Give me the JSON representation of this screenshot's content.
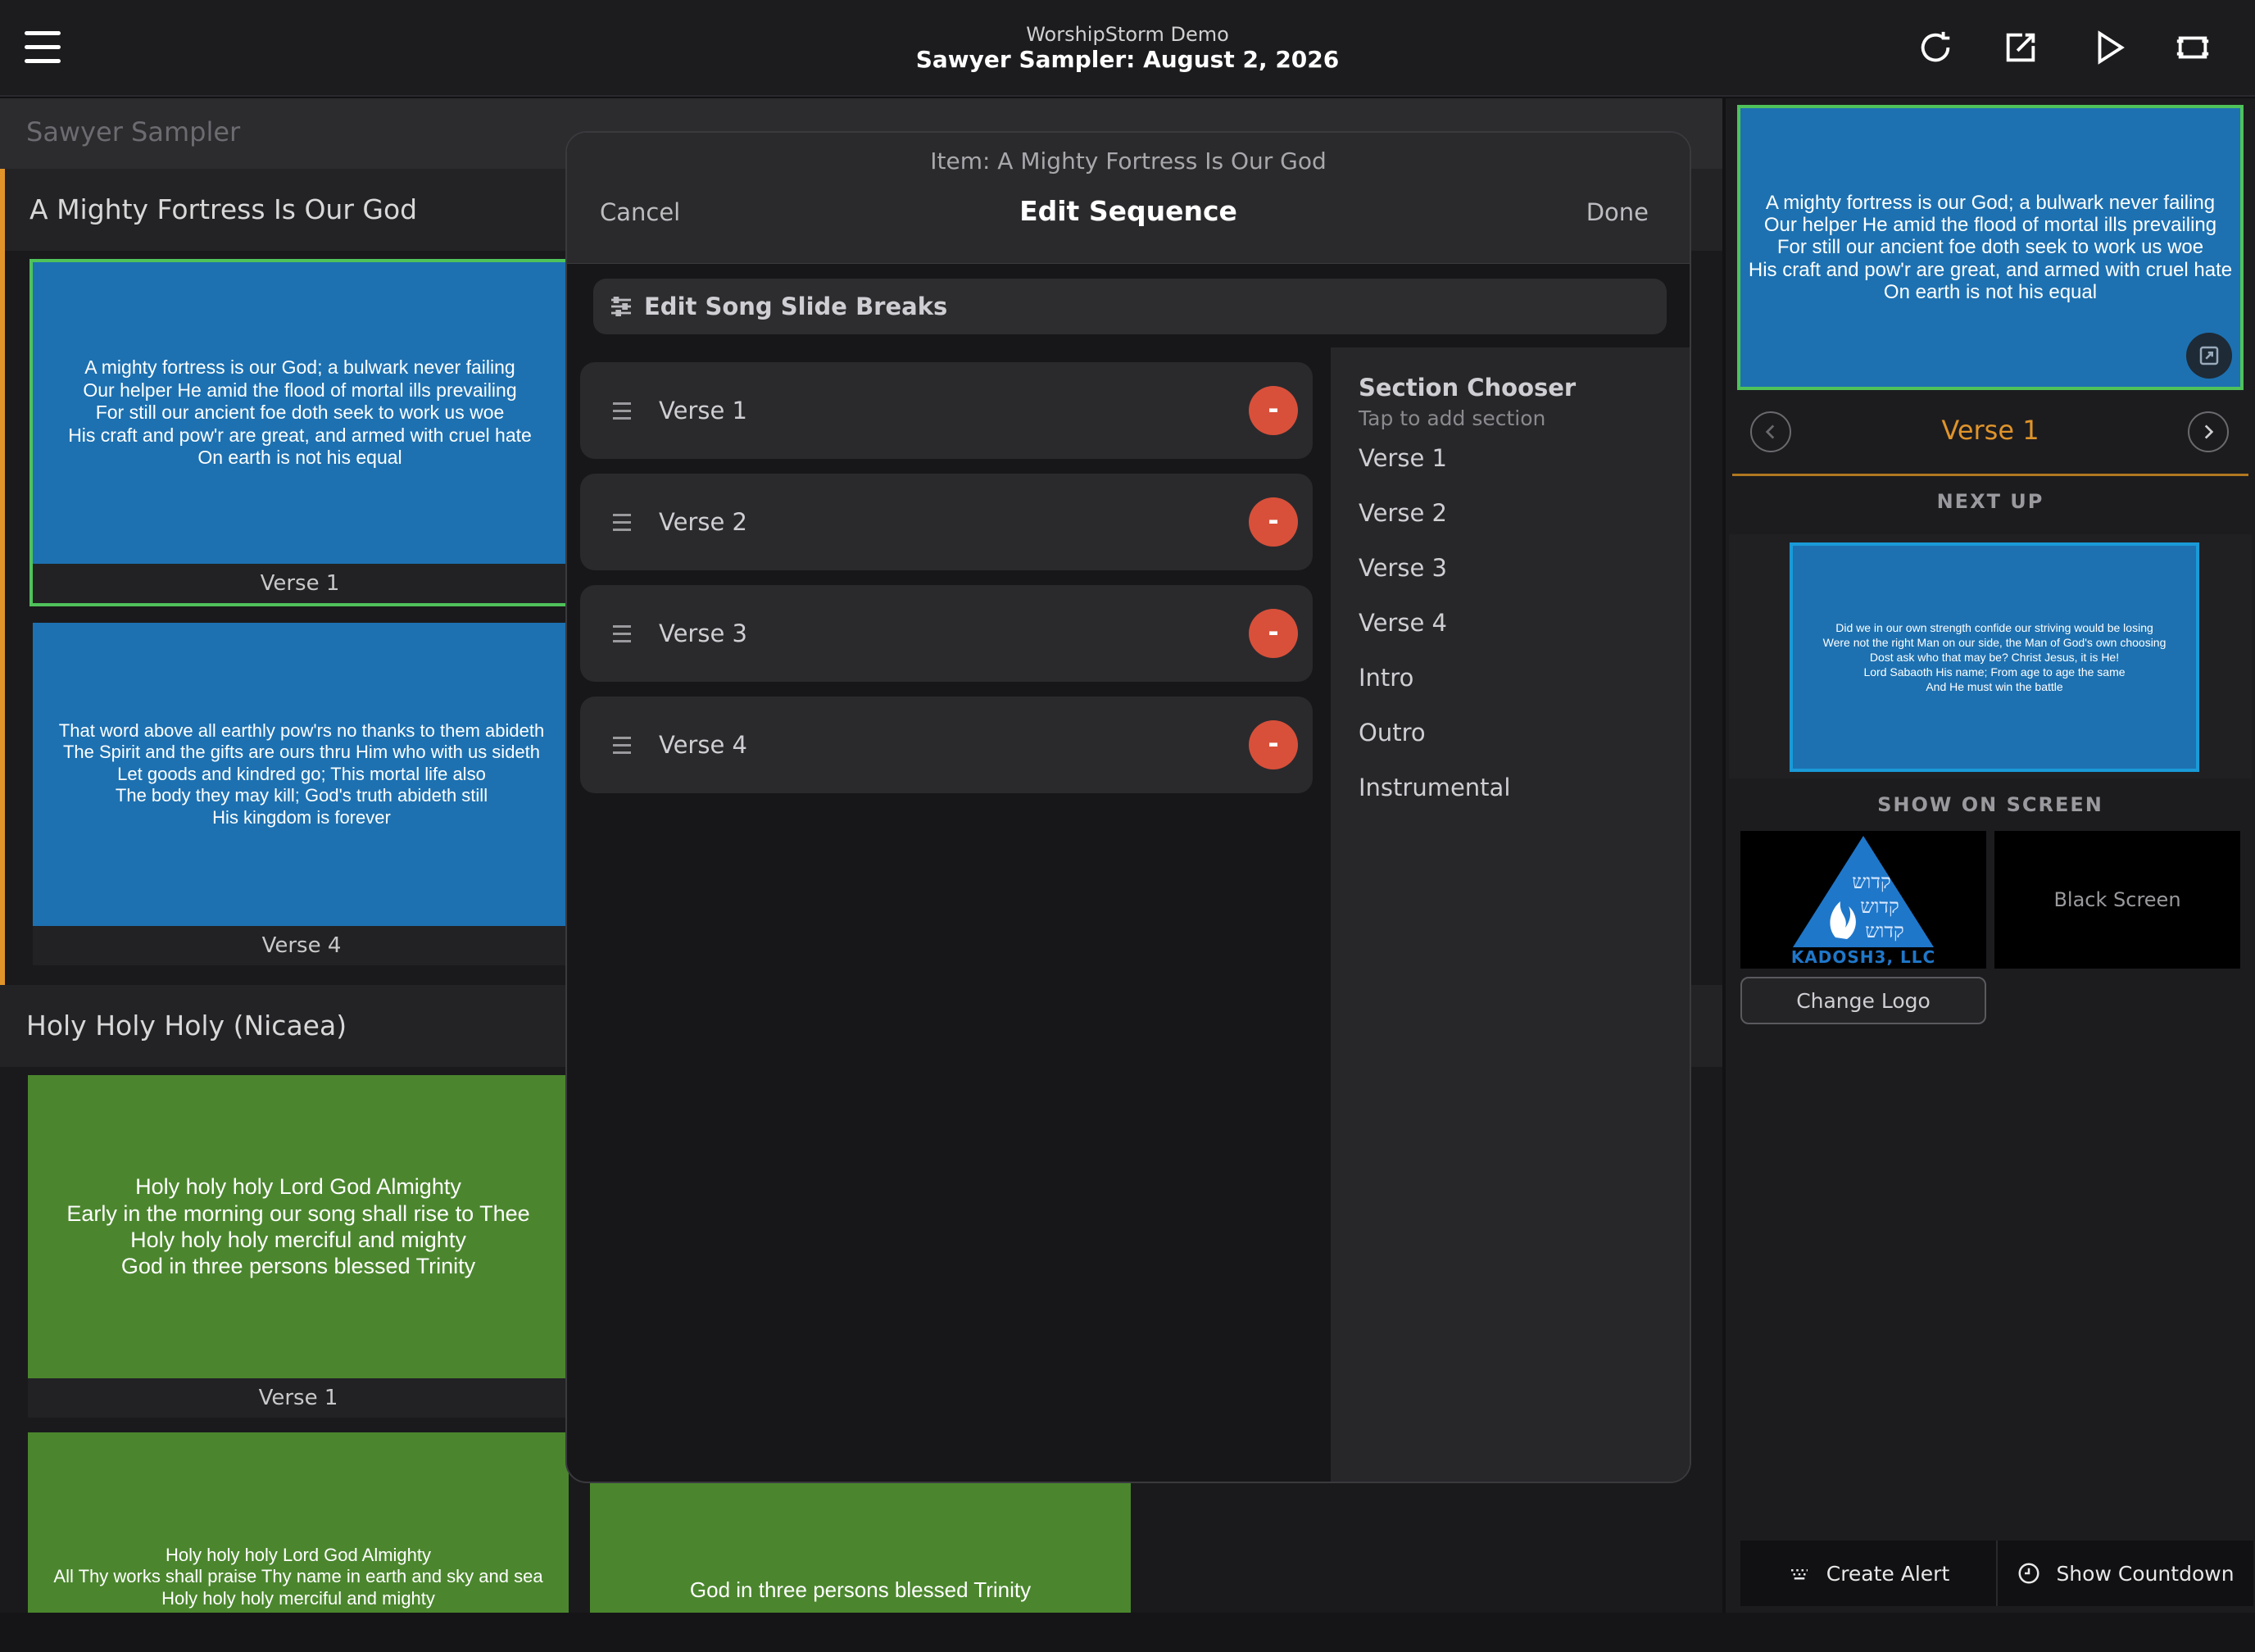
{
  "header": {
    "app_name": "WorshipStorm Demo",
    "plan_title": "Sawyer Sampler: August 2, 2026"
  },
  "plan": {
    "name": "Sawyer Sampler",
    "songs": [
      {
        "title": "A Mighty Fortress Is Our God",
        "slides": [
          {
            "label": "Verse 1",
            "lines": [
              "A mighty fortress is our God; a bulwark never failing",
              "Our helper He amid the flood of mortal ills prevailing",
              "For still our ancient foe doth seek to work us woe",
              "His craft and pow'r are great, and armed with cruel hate",
              "On earth is not his equal"
            ]
          },
          {
            "label": "Verse 4",
            "lines": [
              "That word above all earthly pow'rs no thanks to them abideth",
              "The Spirit and the gifts are ours thru Him who with us sideth",
              "Let goods and kindred go; This mortal life also",
              "The body they may kill; God's truth abideth still",
              "His kingdom is forever"
            ]
          }
        ]
      },
      {
        "title": "Holy Holy Holy (Nicaea)",
        "slides": [
          {
            "label": "Verse 1",
            "lines": [
              "Holy holy holy Lord God Almighty",
              "Early in the morning our song shall rise to Thee",
              "Holy holy holy merciful and mighty",
              "God in three persons blessed Trinity"
            ]
          },
          {
            "label": "",
            "lines": [
              "Holy holy holy Lord God Almighty",
              "All Thy works shall praise Thy name in earth and sky and sea",
              "Holy holy holy merciful and mighty"
            ]
          },
          {
            "label": "",
            "lines": [
              "God in three persons blessed Trinity"
            ]
          }
        ]
      }
    ]
  },
  "modal": {
    "item_label": "Item: A Mighty Fortress Is Our God",
    "cancel": "Cancel",
    "title": "Edit Sequence",
    "done": "Done",
    "breaks_button": "Edit Song Slide Breaks",
    "sequence": [
      "Verse 1",
      "Verse 2",
      "Verse 3",
      "Verse 4"
    ],
    "remove_symbol": "-",
    "chooser": {
      "title": "Section Chooser",
      "subtitle": "Tap to add section",
      "items": [
        "Verse 1",
        "Verse 2",
        "Verse 3",
        "Verse 4",
        "Intro",
        "Outro",
        "Instrumental"
      ]
    }
  },
  "right": {
    "live_lines": [
      "A mighty fortress is our God; a bulwark never failing",
      "Our helper He amid the flood of mortal ills prevailing",
      "For still our ancient foe doth seek to work us woe",
      "His craft and pow'r are great, and armed with cruel hate",
      "On earth is not his equal"
    ],
    "current_section": "Verse 1",
    "next_up_label": "NEXT UP",
    "next_lines": [
      "Did we in our own strength confide our striving would be losing",
      "Were not the right Man on our side, the Man of God's own choosing",
      "Dost ask who that may be? Christ Jesus, it is He!",
      "Lord Sabaoth His name; From age to age the same",
      "And He must win the battle"
    ],
    "show_on_screen_label": "SHOW ON SCREEN",
    "logo_text": "KADOSH3, LLC",
    "black_screen": "Black Screen",
    "change_logo": "Change Logo",
    "create_alert": "Create Alert",
    "show_countdown": "Show Countdown"
  },
  "colors": {
    "accent": "#e0942a",
    "slide_blue": "#1d71b1",
    "slide_green": "#4b862e",
    "remove_red": "#d8503a",
    "live_border": "#4fc25a"
  },
  "icons": [
    "menu-icon",
    "refresh-icon",
    "edit-icon",
    "play-icon",
    "screen-icon",
    "sliders-icon",
    "drag-handle-icon",
    "expand-icon",
    "chevron-left-icon",
    "chevron-right-icon",
    "keyboard-icon",
    "clock-icon"
  ]
}
